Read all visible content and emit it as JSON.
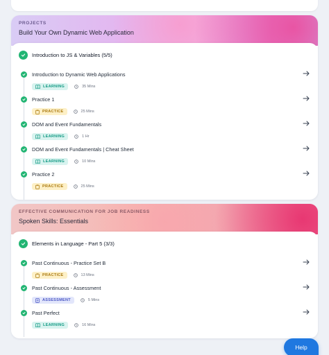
{
  "sections": [
    {
      "category": "PROJECTS",
      "title": "Build Your Own Dynamic Web Application",
      "unit_title": "Introduction to JS & Variables (5/5)",
      "items": [
        {
          "title": "Introduction to Dynamic Web Applications",
          "type": "LEARNING",
          "duration": "35 Mins"
        },
        {
          "title": "Practice 1",
          "type": "PRACTICE",
          "duration": "25 Mins"
        },
        {
          "title": "DOM and Event Fundamentals",
          "type": "LEARNING",
          "duration": "1 Hr"
        },
        {
          "title": "DOM and Event Fundamentals | Cheat Sheet",
          "type": "LEARNING",
          "duration": "10 Mins"
        },
        {
          "title": "Practice 2",
          "type": "PRACTICE",
          "duration": "25 Mins"
        }
      ]
    },
    {
      "category": "EFFECTIVE COMMUNICATION FOR JOB READINESS",
      "title": "Spoken Skills: Essentials",
      "unit_title": "Elements in Language - Part 5 (3/3)",
      "items": [
        {
          "title": "Past Continuous - Practice Set B",
          "type": "PRACTICE",
          "duration": "13 Mins"
        },
        {
          "title": "Past Continuous - Assessment",
          "type": "ASSESSMENT",
          "duration": "5 Mins"
        },
        {
          "title": "Past Perfect",
          "type": "LEARNING",
          "duration": "16 Mins"
        }
      ]
    }
  ],
  "help_label": "Help",
  "colors": {
    "learning_bg": "#d8f3ef",
    "practice_bg": "#fdf0c7",
    "assessment_bg": "#e2e6fb",
    "check_green": "#22b573",
    "help_blue": "#1f78e0"
  }
}
